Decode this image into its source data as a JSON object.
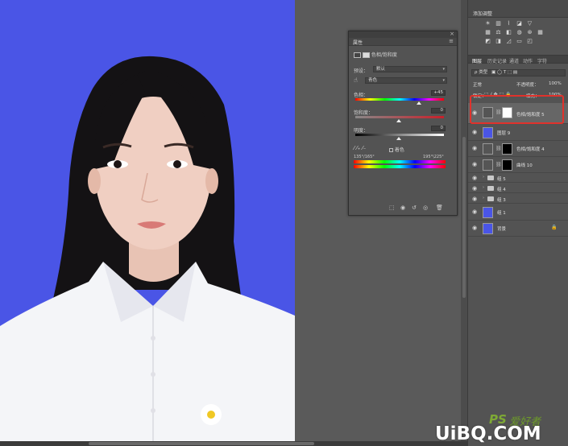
{
  "colors": {
    "background_blue": "#4a55e6",
    "highlight": "#e0322c",
    "panel": "#535353"
  },
  "properties": {
    "tab": "属性",
    "adjustment_name": "色相/饱和度",
    "preset_label": "预设：",
    "preset_value": "默认",
    "channel_value": "青色",
    "hue_label": "色相：",
    "hue_value": "+45",
    "saturation_label": "饱和度：",
    "saturation_value": "0",
    "lightness_label": "明度：",
    "lightness_value": "0",
    "colorize_label": "着色",
    "range_left": "135°/165°",
    "range_right": "195°\\225°"
  },
  "adjustments": {
    "title": "添加调整"
  },
  "layers_panel": {
    "tabs": [
      "图层",
      "历史记录",
      "通道",
      "动作",
      "字符"
    ],
    "kind_filter": "ρ 类型",
    "blend_mode": "正常",
    "opacity_label": "不透明度：",
    "opacity_value": "100%",
    "lock_label": "锁定：",
    "fill_label": "填充：",
    "fill_value": "100%",
    "layers": [
      {
        "name": "色相/饱和度 5"
      },
      {
        "name": "图层 9"
      },
      {
        "name": "色相/饱和度 4"
      },
      {
        "name": "曲线 10"
      },
      {
        "name": "组 5"
      },
      {
        "name": "组 4"
      },
      {
        "name": "组 3"
      },
      {
        "name": "组 1"
      },
      {
        "name": "背景"
      }
    ]
  },
  "watermark": {
    "ps": "PS",
    "cn": "爱好者",
    "url": "UiBQ.COM"
  }
}
